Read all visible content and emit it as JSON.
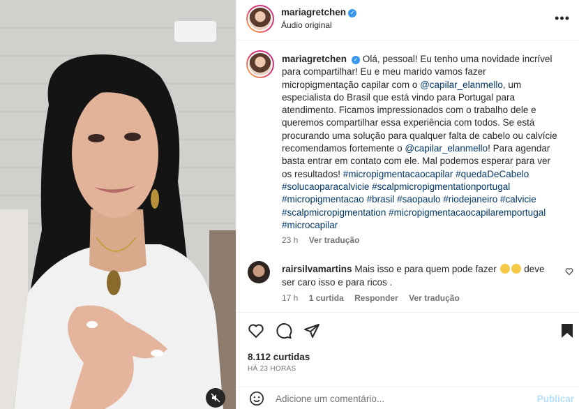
{
  "media": {
    "mute_icon": "speaker-muted-icon"
  },
  "post_header": {
    "username": "mariagretchen",
    "verified": true,
    "audio_label": "Áudio original",
    "more_icon": "more-options-icon"
  },
  "caption": {
    "username": "mariagretchen",
    "text_parts": [
      {
        "t": "Olá, pessoal! Eu tenho uma novidade incrível para compartilhar! Eu e meu marido vamos fazer micropigmentação capilar com o ",
        "link": false
      },
      {
        "t": "@capilar_elanmello",
        "link": true
      },
      {
        "t": ", um especialista do Brasil que está vindo para Portugal para atendimento. Ficamos impressionados com o trabalho dele e queremos compartilhar essa experiência com todos. Se está procurando uma solução para qualquer falta de cabelo ou calvície recomendamos fortemente o ",
        "link": false
      },
      {
        "t": "@capilar_elanmello",
        "link": true
      },
      {
        "t": "! Para agendar basta entrar em contato com ele. Mal podemos esperar para ver os resultados! ",
        "link": false
      },
      {
        "t": "#micropigmentacaocapilar",
        "link": true
      },
      {
        "t": " ",
        "link": false
      },
      {
        "t": "#quedaDeCabelo",
        "link": true
      },
      {
        "t": " ",
        "link": false
      },
      {
        "t": "#solucaoparacalvicie",
        "link": true
      },
      {
        "t": " ",
        "link": false
      },
      {
        "t": "#scalpmicropigmentationportugal",
        "link": true
      },
      {
        "t": " ",
        "link": false
      },
      {
        "t": "#micropigmentacao",
        "link": true
      },
      {
        "t": " ",
        "link": false
      },
      {
        "t": "#brasil",
        "link": true
      },
      {
        "t": " ",
        "link": false
      },
      {
        "t": "#saopaulo",
        "link": true
      },
      {
        "t": " ",
        "link": false
      },
      {
        "t": "#riodejaneiro",
        "link": true
      },
      {
        "t": " ",
        "link": false
      },
      {
        "t": "#calvicie",
        "link": true
      },
      {
        "t": " ",
        "link": false
      },
      {
        "t": "#scalpmicropigmentation",
        "link": true
      },
      {
        "t": " ",
        "link": false
      },
      {
        "t": "#micropigmentacaocapilaremportugal",
        "link": true
      },
      {
        "t": " ",
        "link": false
      },
      {
        "t": "#microcapilar",
        "link": true
      }
    ],
    "time": "23 h",
    "translate": "Ver tradução"
  },
  "comment": {
    "username": "rairsilvamartins",
    "text_before": "Mais isso e para quem pode fazer",
    "text_after": " deve ser caro isso e para ricos .",
    "emojis": [
      "rofl-emoji",
      "rofl-emoji"
    ],
    "time": "17 h",
    "likes": "1 curtida",
    "reply": "Responder",
    "translate": "Ver tradução"
  },
  "actions": {
    "likes": "8.112 curtidas",
    "date": "HÁ 23 HORAS"
  },
  "add_comment": {
    "placeholder": "Adicione um comentário...",
    "publish": "Publicar"
  },
  "colors": {
    "link": "#00376b",
    "verified": "#3897f0",
    "muted_text": "#737373",
    "publish_disabled": "#b2dffc"
  }
}
